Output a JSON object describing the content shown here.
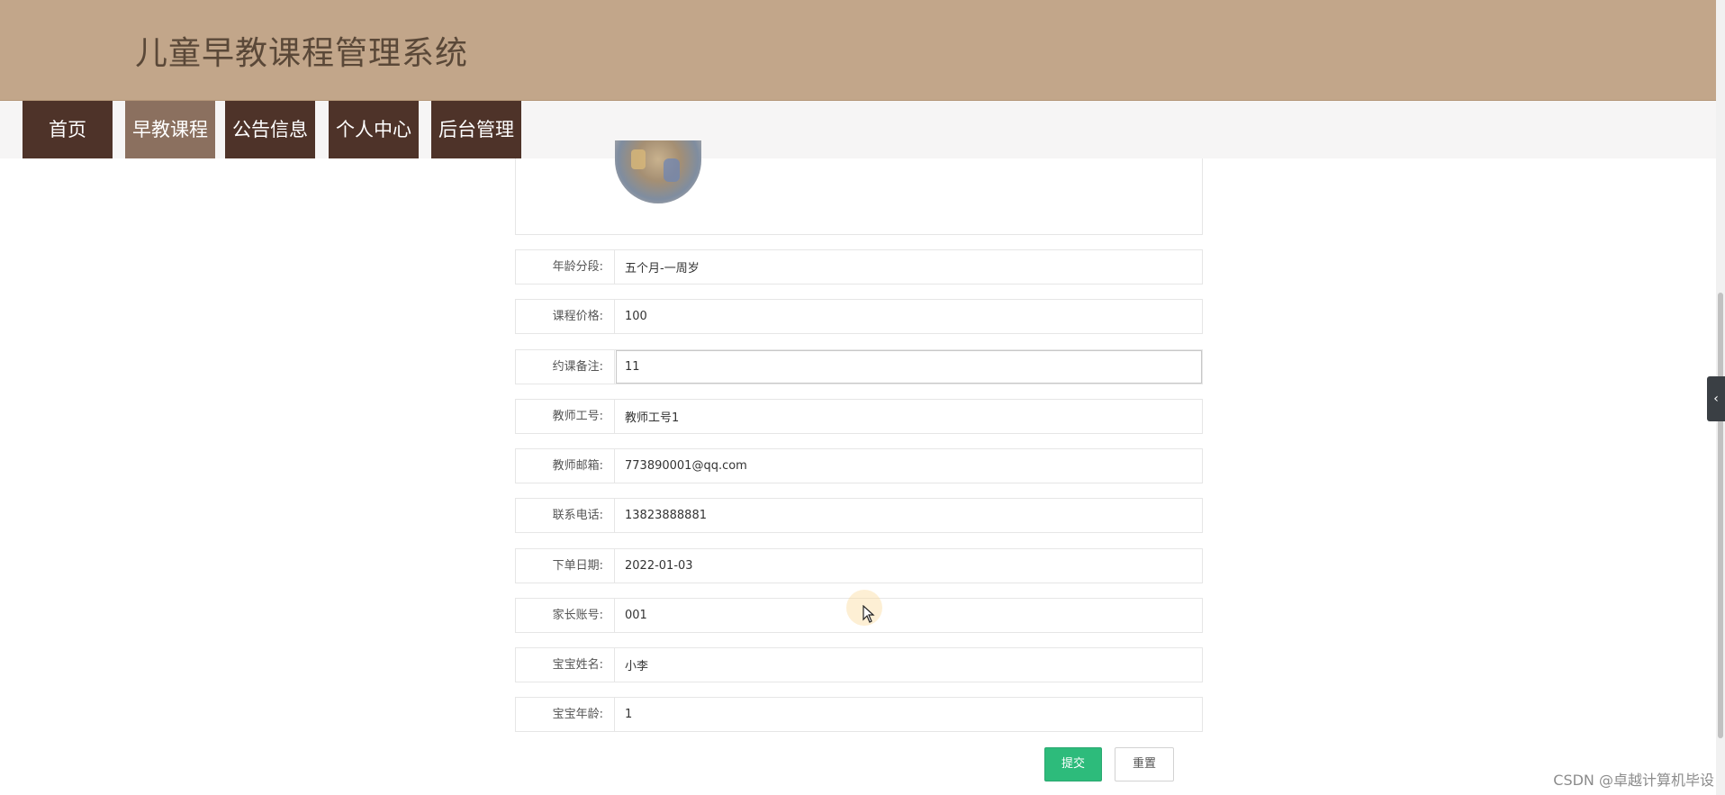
{
  "header": {
    "title": "儿童早教课程管理系统"
  },
  "nav": {
    "items": [
      {
        "label": "首页",
        "active": false
      },
      {
        "label": "早教课程",
        "active": true
      },
      {
        "label": "公告信息",
        "active": false
      },
      {
        "label": "个人中心",
        "active": false
      },
      {
        "label": "后台管理",
        "active": false
      }
    ]
  },
  "form": {
    "fields": [
      {
        "label": "年龄分段:",
        "value": "五个月-一周岁"
      },
      {
        "label": "课程价格:",
        "value": "100"
      },
      {
        "label": "约课备注:",
        "value": "11"
      },
      {
        "label": "教师工号:",
        "value": "教师工号1"
      },
      {
        "label": "教师邮箱:",
        "value": "773890001@qq.com"
      },
      {
        "label": "联系电话:",
        "value": "13823888881"
      },
      {
        "label": "下单日期:",
        "value": "2022-01-03"
      },
      {
        "label": "家长账号:",
        "value": "001"
      },
      {
        "label": "宝宝姓名:",
        "value": "小李"
      },
      {
        "label": "宝宝年龄:",
        "value": "1"
      }
    ],
    "submit_label": "提交",
    "reset_label": "重置"
  },
  "sidebar_toggle": {
    "icon": "chevron-left-icon",
    "glyph": "‹"
  },
  "watermark": "CSDN @卓越计算机毕设",
  "colors": {
    "header_bg": "#c2a68a",
    "nav_bg": "#4e3329",
    "nav_active_bg": "#8b705f",
    "submit_bg": "#2dbb7b"
  }
}
